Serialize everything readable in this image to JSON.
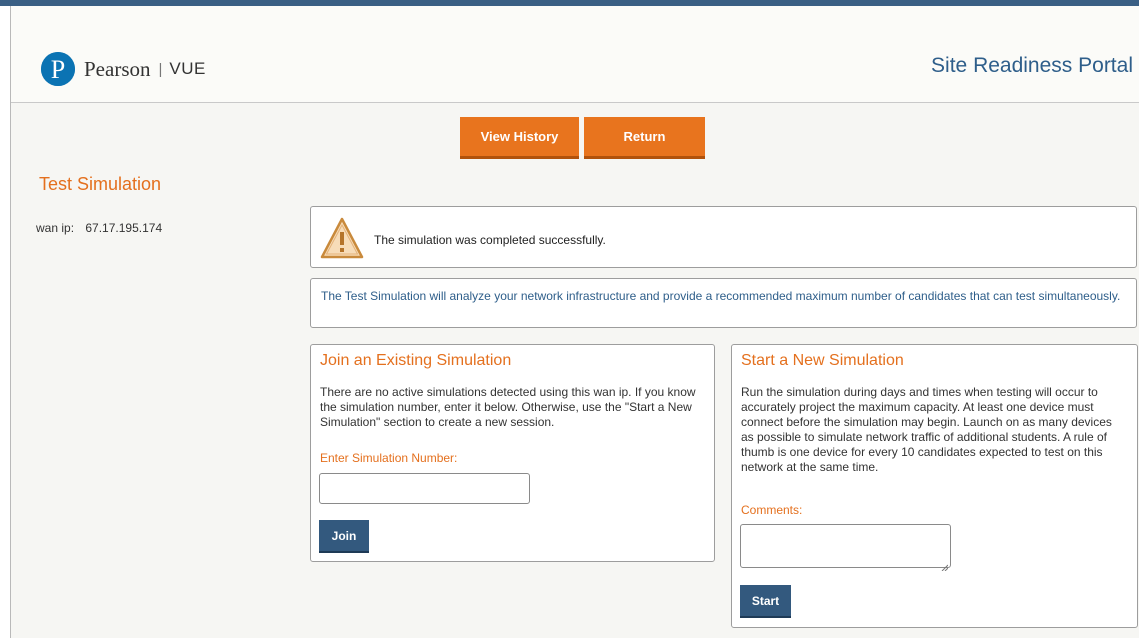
{
  "header": {
    "logo_name": "Pearson",
    "logo_sep": "|",
    "logo_sub": "VUE",
    "portal_title": "Site Readiness Portal"
  },
  "toolbar": {
    "view_history_label": "View History",
    "return_label": "Return"
  },
  "page": {
    "title": "Test Simulation",
    "wan_label": "wan ip:",
    "wan_value": "67.17.195.174"
  },
  "alert": {
    "icon": "warning-icon",
    "message": "The simulation was completed successfully."
  },
  "info": {
    "text": "The Test Simulation will analyze your network infrastructure and provide a recommended maximum number of candidates that can test simultaneously."
  },
  "join_panel": {
    "title": "Join an Existing Simulation",
    "description": "There are no active simulations detected using this wan ip. If you know the simulation number, enter it below. Otherwise, use the \"Start a New Simulation\" section to create a new session.",
    "field_label": "Enter Simulation Number:",
    "input_value": "",
    "button_label": "Join"
  },
  "start_panel": {
    "title": "Start a New Simulation",
    "description": "Run the simulation during days and times when testing will occur to accurately project the maximum capacity. At least one device must connect before the simulation may begin. Launch on as many devices as possible to simulate network traffic of additional students. A rule of thumb is one device for every 10 candidates expected to test on this network at the same time.",
    "field_label": "Comments:",
    "comments_value": "",
    "button_label": "Start"
  },
  "colors": {
    "accent_orange": "#e8741e",
    "primary_blue": "#33597e",
    "title_blue": "#2e5e8a",
    "topbar": "#3a5f84"
  }
}
